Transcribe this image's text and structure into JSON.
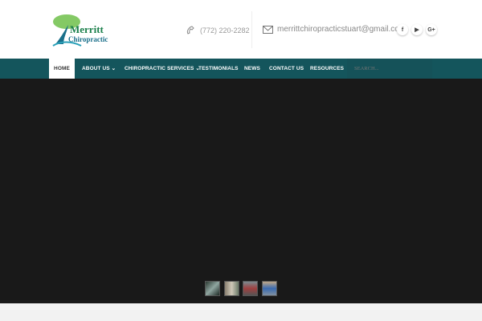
{
  "header": {
    "logo": {
      "line1": "Merritt",
      "line2": "Chiropractic"
    },
    "phone": "(772) 220-2282",
    "email": "merrittchiropracticstuart@gmail.com",
    "social": [
      {
        "icon": "facebook-icon",
        "glyph": "f"
      },
      {
        "icon": "youtube-icon",
        "glyph": "▶"
      },
      {
        "icon": "google-plus-icon",
        "glyph": "G+"
      }
    ]
  },
  "nav": {
    "items": [
      {
        "label": "HOME",
        "active": true
      },
      {
        "label": "ABOUT US ⌄"
      },
      {
        "label": "CHIROPRACTIC SERVICES ⌄"
      },
      {
        "label": "TESTIMONIALS"
      },
      {
        "label": "NEWS"
      },
      {
        "label": "CONTACT US"
      },
      {
        "label": "RESOURCES"
      }
    ],
    "search_placeholder": "SEARCH..."
  },
  "colors": {
    "nav": "#14555c",
    "stage": "#191919"
  }
}
